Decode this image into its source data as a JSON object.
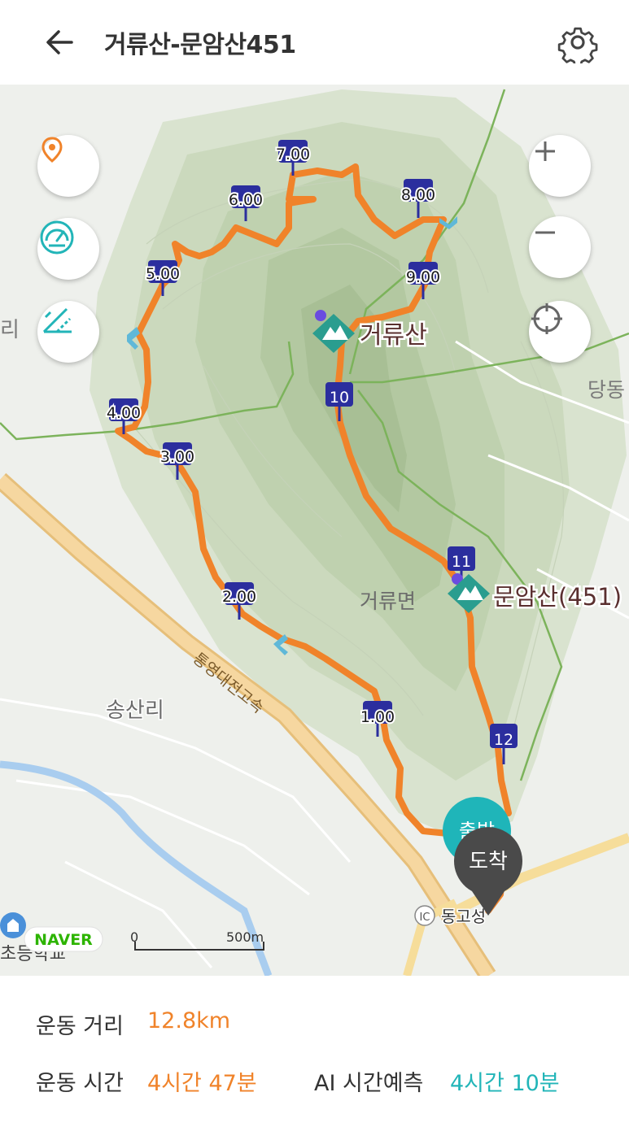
{
  "header": {
    "title": "거류산-문암산451"
  },
  "map": {
    "peaks": [
      {
        "name": "거류산"
      },
      {
        "name": "문암산(451)"
      }
    ],
    "place_labels": {
      "area": "거류면",
      "village": "송산리",
      "highway": "통영대전고속",
      "left_edge": "리",
      "right_edge": "당동",
      "ic": "동고성",
      "school": "초등학교"
    },
    "markers": [
      "1.00",
      "2.00",
      "3.00",
      "4.00",
      "5.00",
      "6.00",
      "7.00",
      "8.00",
      "9.00",
      "10",
      "11",
      "12"
    ],
    "start_label": "출발",
    "end_label": "도착",
    "ic_badge": "IC",
    "naver": "NAVER",
    "scale": {
      "zero": "0",
      "dist": "500m"
    },
    "colors": {
      "route": "#f0832a",
      "marker": "#2b2e9e",
      "teal": "#1fb5b9",
      "peak": "#2a9d8f"
    }
  },
  "stats": {
    "distance_label": "운동 거리",
    "distance_value": "12.8km",
    "time_label": "운동 시간",
    "time_value": "4시간 47분",
    "ai_label": "AI 시간예측",
    "ai_value": "4시간 10분"
  }
}
